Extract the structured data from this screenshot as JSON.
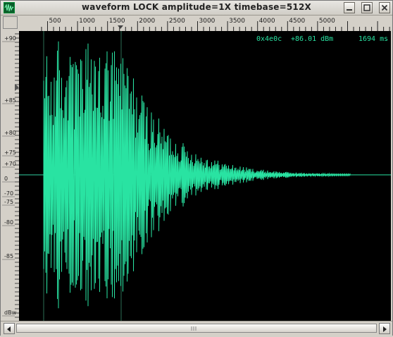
{
  "window": {
    "title": "waveform  LOCK amplitude=1X timebase=512X"
  },
  "titlebar_buttons": [
    {
      "name": "minimize-button",
      "icon": "minimize-icon"
    },
    {
      "name": "maximize-button",
      "icon": "maximize-icon"
    },
    {
      "name": "close-button",
      "icon": "close-icon"
    }
  ],
  "time_ruler": {
    "labels": [
      "500",
      "1000",
      "1500",
      "2000",
      "2500",
      "3000",
      "3500",
      "4000",
      "4500",
      "5000"
    ],
    "marker_label": "playhead-marker"
  },
  "amplitude_axis": {
    "labels": [
      "+90",
      "+85",
      "+80",
      "+75",
      "+70",
      "0",
      "-70",
      "-75",
      "-80",
      "-85",
      "dBw"
    ],
    "pointer_label": "level-pointer"
  },
  "readout": {
    "address": "0x4e0c",
    "level": "+86.01 dBm",
    "time": "1694 ms"
  },
  "colors": {
    "trace": "#29e3a2",
    "background": "#000000",
    "chrome": "#d4d0c8"
  }
}
